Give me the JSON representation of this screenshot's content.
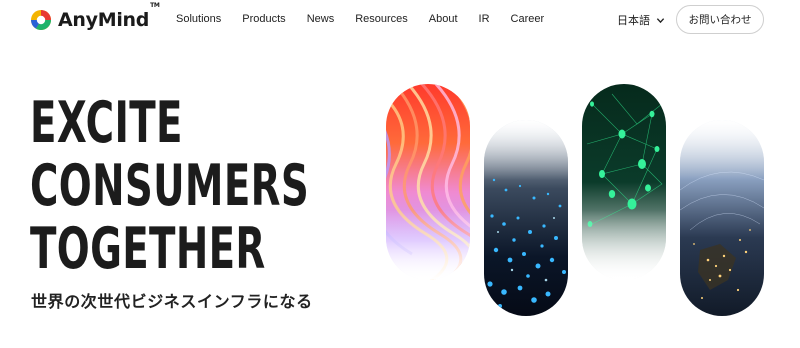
{
  "header": {
    "logo_text": "AnyMind",
    "logo_tm": "TM",
    "nav": [
      "Solutions",
      "Products",
      "News",
      "Resources",
      "About",
      "IR",
      "Career"
    ],
    "language": "日本語",
    "contact_label": "お問い合わせ"
  },
  "hero": {
    "title_lines": [
      "EXCITE",
      "CONSUMERS",
      "TOGETHER"
    ],
    "subtitle": "世界の次世代ビジネスインフラになる"
  },
  "colors": {
    "text": "#1c1c1c",
    "logo_red": "#e8392f",
    "logo_green": "#1fb36b",
    "logo_blue": "#2a62d6",
    "logo_yellow": "#f4b400"
  },
  "images": [
    {
      "name": "waves-image",
      "icon": "colorful-light-waves"
    },
    {
      "name": "digital-particles-image",
      "icon": "blue-particle-grid"
    },
    {
      "name": "network-image",
      "icon": "green-network-nodes"
    },
    {
      "name": "earth-lights-image",
      "icon": "earth-city-lights"
    }
  ]
}
